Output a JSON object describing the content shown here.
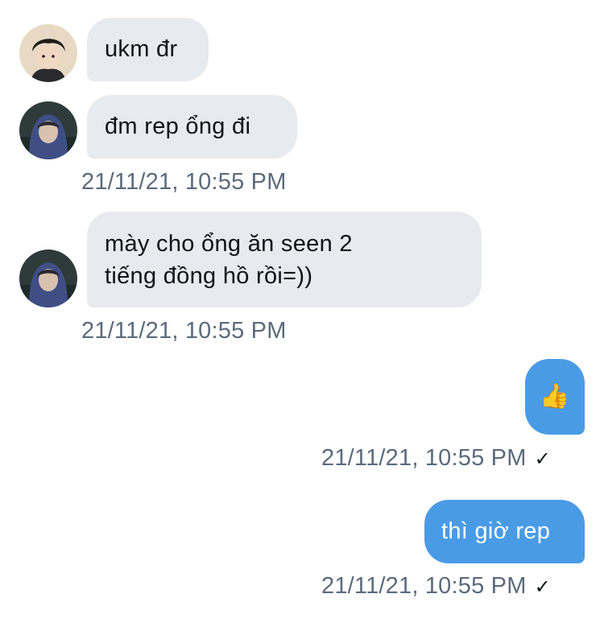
{
  "messages": [
    {
      "direction": "incoming",
      "sender_avatar": "avatar-person-dark-hair-icon",
      "text": "ukm đr"
    },
    {
      "direction": "incoming",
      "sender_avatar": "avatar-hooded-person-icon",
      "text": "đm rep ổng đi",
      "timestamp": "21/11/21, 10:55 PM"
    },
    {
      "direction": "incoming",
      "sender_avatar": "avatar-hooded-person-icon",
      "lines": [
        "mày cho ổng ăn seen 2",
        "tiếng đồng hồ rồi=))"
      ],
      "timestamp": "21/11/21, 10:55 PM"
    },
    {
      "direction": "outgoing",
      "text": "👍",
      "timestamp": "21/11/21, 10:55 PM",
      "status": "✓"
    },
    {
      "direction": "outgoing",
      "text": "thì giờ rep",
      "timestamp": "21/11/21, 10:55 PM",
      "status": "✓"
    }
  ],
  "colors": {
    "incoming_bubble": "#e7eaee",
    "outgoing_bubble": "#4a9be6",
    "timestamp_text": "#5b6b7b"
  }
}
